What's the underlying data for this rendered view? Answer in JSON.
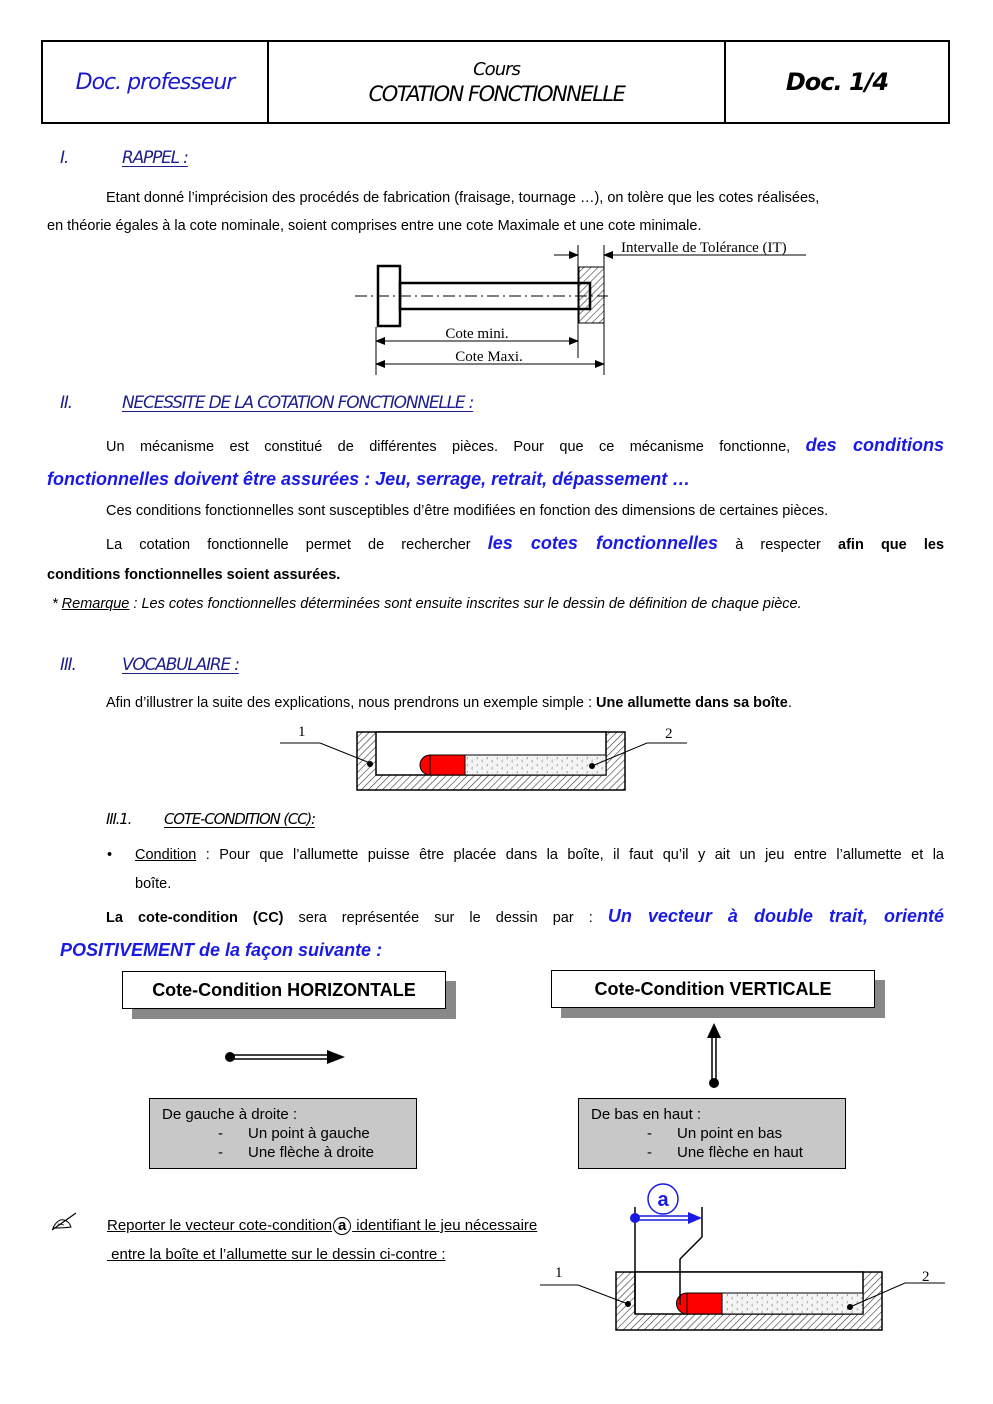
{
  "header": {
    "left": "Doc. professeur",
    "center_top": "Cours",
    "center_bottom": "COTATION FONCTIONNELLE",
    "right": "Doc. 1/4"
  },
  "sections": [
    {
      "num": "I.",
      "title": "RAPPEL :"
    },
    {
      "num": "II.",
      "title": "NECESSITE DE LA COTATION FONCTIONNELLE :"
    },
    {
      "num": "III.",
      "title": "VOCABULAIRE :"
    }
  ],
  "rappel": {
    "line1": "Etant donné l’imprécision des procédés de fabrication (fraisage, tournage …), on tolère que les cotes réalisées,",
    "line2": "en théorie égales à la cote nominale, soient comprises entre une cote Maximale et une cote minimale."
  },
  "fig1": {
    "it_label": "Intervalle de Tolérance (IT)",
    "cote_mini": "Cote mini.",
    "cote_maxi": "Cote Maxi."
  },
  "necessite": {
    "p1_start": "Un mécanisme est constitué de différentes pièces. Pour que ce mécanisme fonctionne,",
    "p1_blue_a": "des conditions",
    "p1_blue_b": "fonctionnelles doivent être assurées : Jeu, serrage, retrait, dépassement …",
    "p2": "Ces conditions fonctionnelles sont susceptibles d’être modifiées en fonction des dimensions de certaines pièces.",
    "p3_start": "La cotation fonctionnelle permet de rechercher",
    "p3_blue": "les cotes fonctionnelles",
    "p3_mid": "à respecter",
    "p3_bold_a": "afin que les",
    "p3_bold_b": "conditions fonctionnelles soient assurées.",
    "remark_star": "* ",
    "remark_label": "Remarque",
    "remark_text": " : Les cotes fonctionnelles déterminées sont ensuite inscrites sur le dessin de définition de chaque pièce."
  },
  "vocabulaire": {
    "intro": "Afin d’illustrer la suite des explications, nous prendrons un exemple simple : ",
    "intro_bold": "Une allumette dans sa boîte",
    "intro_end": ".",
    "fig_label_1": "1",
    "fig_label_2": "2"
  },
  "subsection": {
    "num": "III.1.",
    "title": "COTE-CONDITION (CC):"
  },
  "condition": {
    "label": "Condition",
    "text_a": " : Pour que l’allumette puisse être placée dans la boîte, il faut qu’il y ait un jeu entre l’allumette et la",
    "text_b": "boîte."
  },
  "cc_repr": {
    "bold": "La cote-condition (CC)",
    "mid": " sera représentée sur le dessin par :",
    "blue_a": "Un vecteur à double trait, orienté",
    "blue_b": "POSITIVEMENT de la façon suivante :"
  },
  "horizontal": {
    "title": "Cote-Condition HORIZONTALE",
    "box_title": "De gauche à droite :",
    "items": [
      "Un point à gauche",
      "Une flèche à droite"
    ]
  },
  "vertical": {
    "title": "Cote-Condition VERTICALE",
    "box_title": "De bas en haut :",
    "items": [
      "Un point en bas",
      "Une flèche en haut"
    ]
  },
  "exercise": {
    "icon": "pencil-writing-icon",
    "line1_a": "Reporter le vecteur cote-condition",
    "circle_label": "a",
    "line1_b": " identifiant le jeu nécessaire",
    "line2": " entre la boîte et l’allumette sur le dessin ci-contre :",
    "fig_label_1": "1",
    "fig_label_2": "2",
    "vector_label": "a"
  },
  "colors": {
    "accent_blue": "#1a1ae6",
    "heading_blue": "#1e1e8c",
    "match_red": "#ff0000",
    "box_grey": "#c8c8c8"
  }
}
